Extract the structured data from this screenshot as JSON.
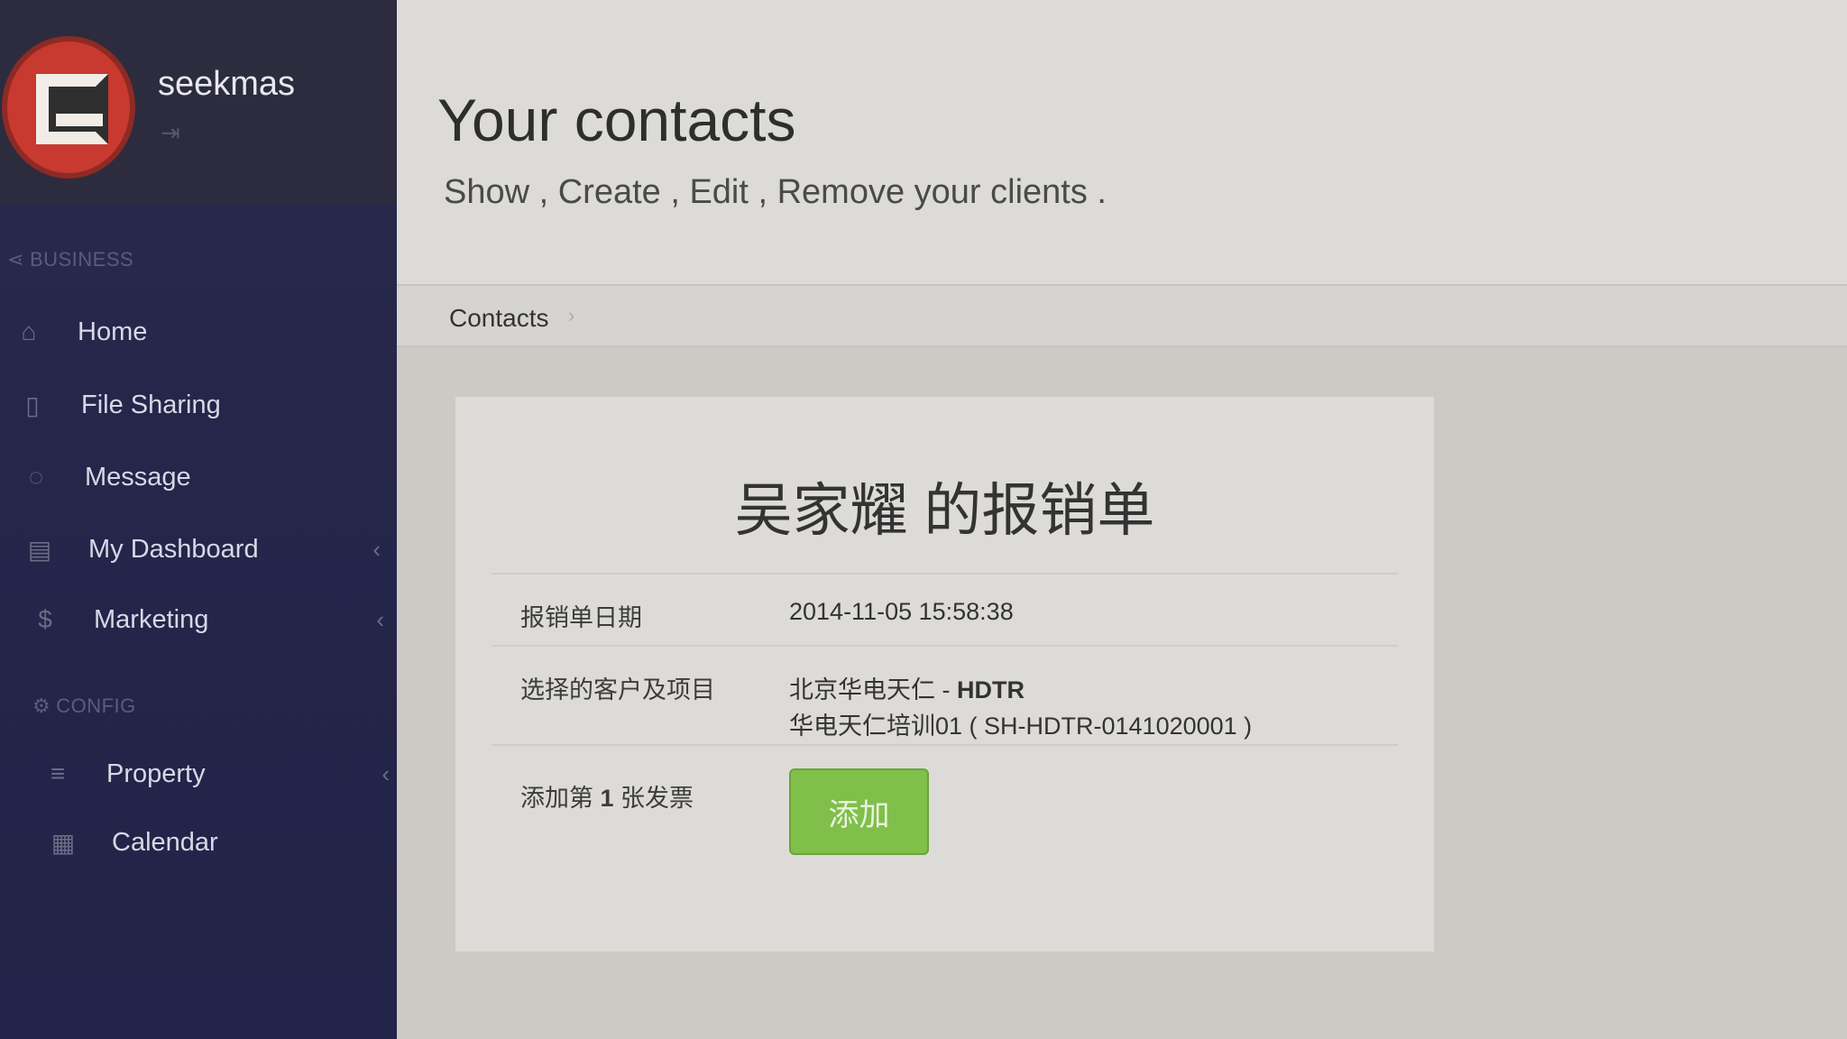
{
  "sidebar": {
    "username": "seekmas",
    "signout_icon": "sign-in-icon",
    "sections": {
      "business": "BUSINESS",
      "config": "CONFIG"
    },
    "items": [
      {
        "label": "Home",
        "icon": "home-icon"
      },
      {
        "label": "File Sharing",
        "icon": "file-icon"
      },
      {
        "label": "Message",
        "icon": "chat-icon"
      },
      {
        "label": "My Dashboard",
        "icon": "dashboard-icon",
        "has_arrow": true
      },
      {
        "label": "Marketing",
        "icon": "dollar-icon",
        "has_arrow": true
      },
      {
        "label": "Property",
        "icon": "database-icon",
        "has_arrow": true
      },
      {
        "label": "Calendar",
        "icon": "calendar-icon"
      }
    ],
    "arrow_glyph": "‹"
  },
  "header": {
    "title": "Your contacts",
    "subtitle": "Show , Create , Edit , Remove your clients ."
  },
  "breadcrumb": {
    "current": "Contacts",
    "separator": "›"
  },
  "card": {
    "title": "吴家耀 的报销单",
    "rows": [
      {
        "label": "报销单日期",
        "value": "2014-11-05 15:58:38"
      },
      {
        "label": "选择的客户及项目",
        "value_line1_prefix": "北京华电天仁 - ",
        "value_line1_strong": "HDTR",
        "value_line2": "华电天仁培训01 ( SH-HDTR-0141020001 )"
      },
      {
        "label_prefix": "添加第 ",
        "label_strong": "1",
        "label_suffix": " 张发票"
      }
    ],
    "add_button_label": "添加"
  },
  "colors": {
    "sidebar_bg": "#25264a",
    "avatar_red": "#c8392f",
    "add_button_green": "#7fbf4a"
  }
}
